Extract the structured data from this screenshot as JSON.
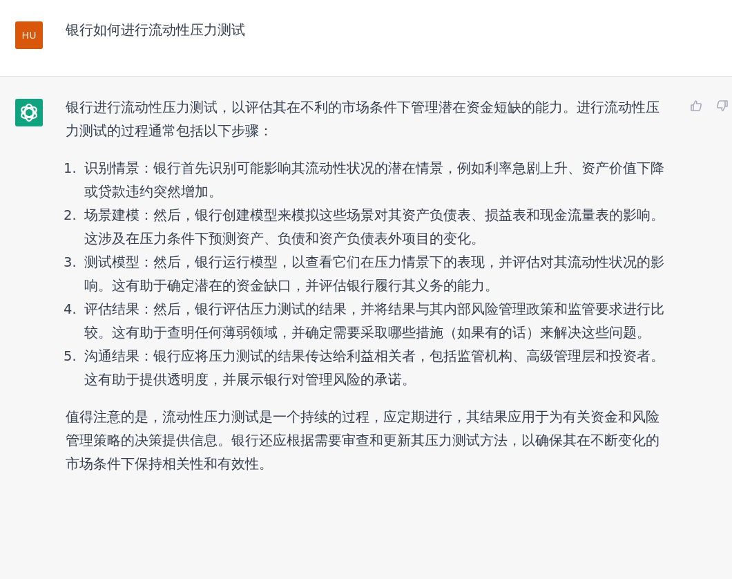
{
  "question": {
    "avatar": "HU",
    "text": "银行如何进行流动性压力测试"
  },
  "answer": {
    "intro": "银行进行流动性压力测试，以评估其在不利的市场条件下管理潜在资金短缺的能力。进行流动性压力测试的过程通常包括以下步骤：",
    "steps": [
      {
        "number": "1.",
        "text": "识别情景：银行首先识别可能影响其流动性状况的潜在情景，例如利率急剧上升、资产价值下降或贷款违约突然增加。"
      },
      {
        "number": "2.",
        "text": "场景建模：然后，银行创建模型来模拟这些场景对其资产负债表、损益表和现金流量表的影响。这涉及在压力条件下预测资产、负债和资产负债表外项目的变化。"
      },
      {
        "number": "3.",
        "text": "测试模型：然后，银行运行模型，以查看它们在压力情景下的表现，并评估对其流动性状况的影响。这有助于确定潜在的资金缺口，并评估银行履行其义务的能力。"
      },
      {
        "number": "4.",
        "text": "评估结果：然后，银行评估压力测试的结果，并将结果与其内部风险管理政策和监管要求进行比较。这有助于查明任何薄弱领域，并确定需要采取哪些措施（如果有的话）来解决这些问题。"
      },
      {
        "number": "5.",
        "text": "沟通结果：银行应将压力测试的结果传达给利益相关者，包括监管机构、高级管理层和投资者。这有助于提供透明度，并展示银行对管理风险的承诺。"
      }
    ],
    "conclusion": "值得注意的是，流动性压力测试是一个持续的过程，应定期进行，其结果应用于为有关资金和风险管理策略的决策提供信息。银行还应根据需要审查和更新其压力测试方法，以确保其在不断变化的市场条件下保持相关性和有效性。"
  }
}
